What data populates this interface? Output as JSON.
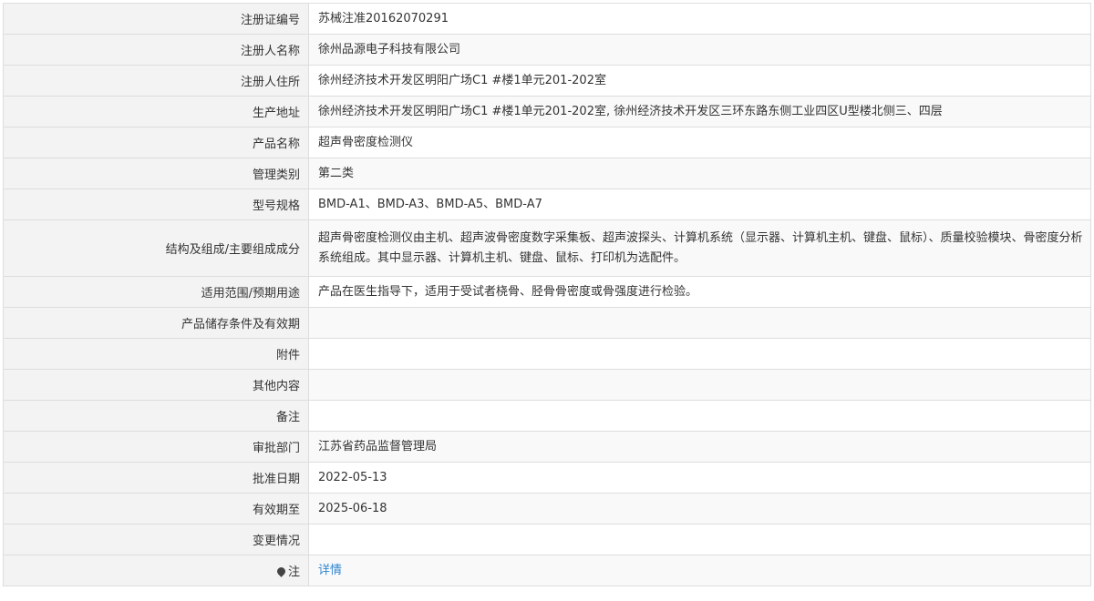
{
  "rows": [
    {
      "label": "注册证编号",
      "value": "苏械注准20162070291"
    },
    {
      "label": "注册人名称",
      "value": "徐州品源电子科技有限公司"
    },
    {
      "label": "注册人住所",
      "value": "徐州经济技术开发区明阳广场C1 #楼1单元201-202室"
    },
    {
      "label": "生产地址",
      "value": "徐州经济技术开发区明阳广场C1 #楼1单元201-202室, 徐州经济技术开发区三环东路东侧工业四区U型楼北侧三、四层"
    },
    {
      "label": "产品名称",
      "value": "超声骨密度检测仪"
    },
    {
      "label": "管理类别",
      "value": "第二类"
    },
    {
      "label": "型号规格",
      "value": "BMD-A1、BMD-A3、BMD-A5、BMD-A7"
    },
    {
      "label": "结构及组成/主要组成成分",
      "value": "超声骨密度检测仪由主机、超声波骨密度数字采集板、超声波探头、计算机系统（显示器、计算机主机、键盘、鼠标）、质量校验模块、骨密度分析系统组成。其中显示器、计算机主机、键盘、鼠标、打印机为选配件。"
    },
    {
      "label": "适用范围/预期用途",
      "value": "产品在医生指导下，适用于受试者桡骨、胫骨骨密度或骨强度进行检验。"
    },
    {
      "label": "产品储存条件及有效期",
      "value": ""
    },
    {
      "label": "附件",
      "value": ""
    },
    {
      "label": "其他内容",
      "value": ""
    },
    {
      "label": "备注",
      "value": ""
    },
    {
      "label": "审批部门",
      "value": "江苏省药品监督管理局"
    },
    {
      "label": "批准日期",
      "value": "2022-05-13"
    },
    {
      "label": "有效期至",
      "value": "2025-06-18"
    },
    {
      "label": "变更情况",
      "value": ""
    }
  ],
  "note": {
    "label": "注",
    "icon": "map-pin-icon",
    "link_text": "详情"
  }
}
